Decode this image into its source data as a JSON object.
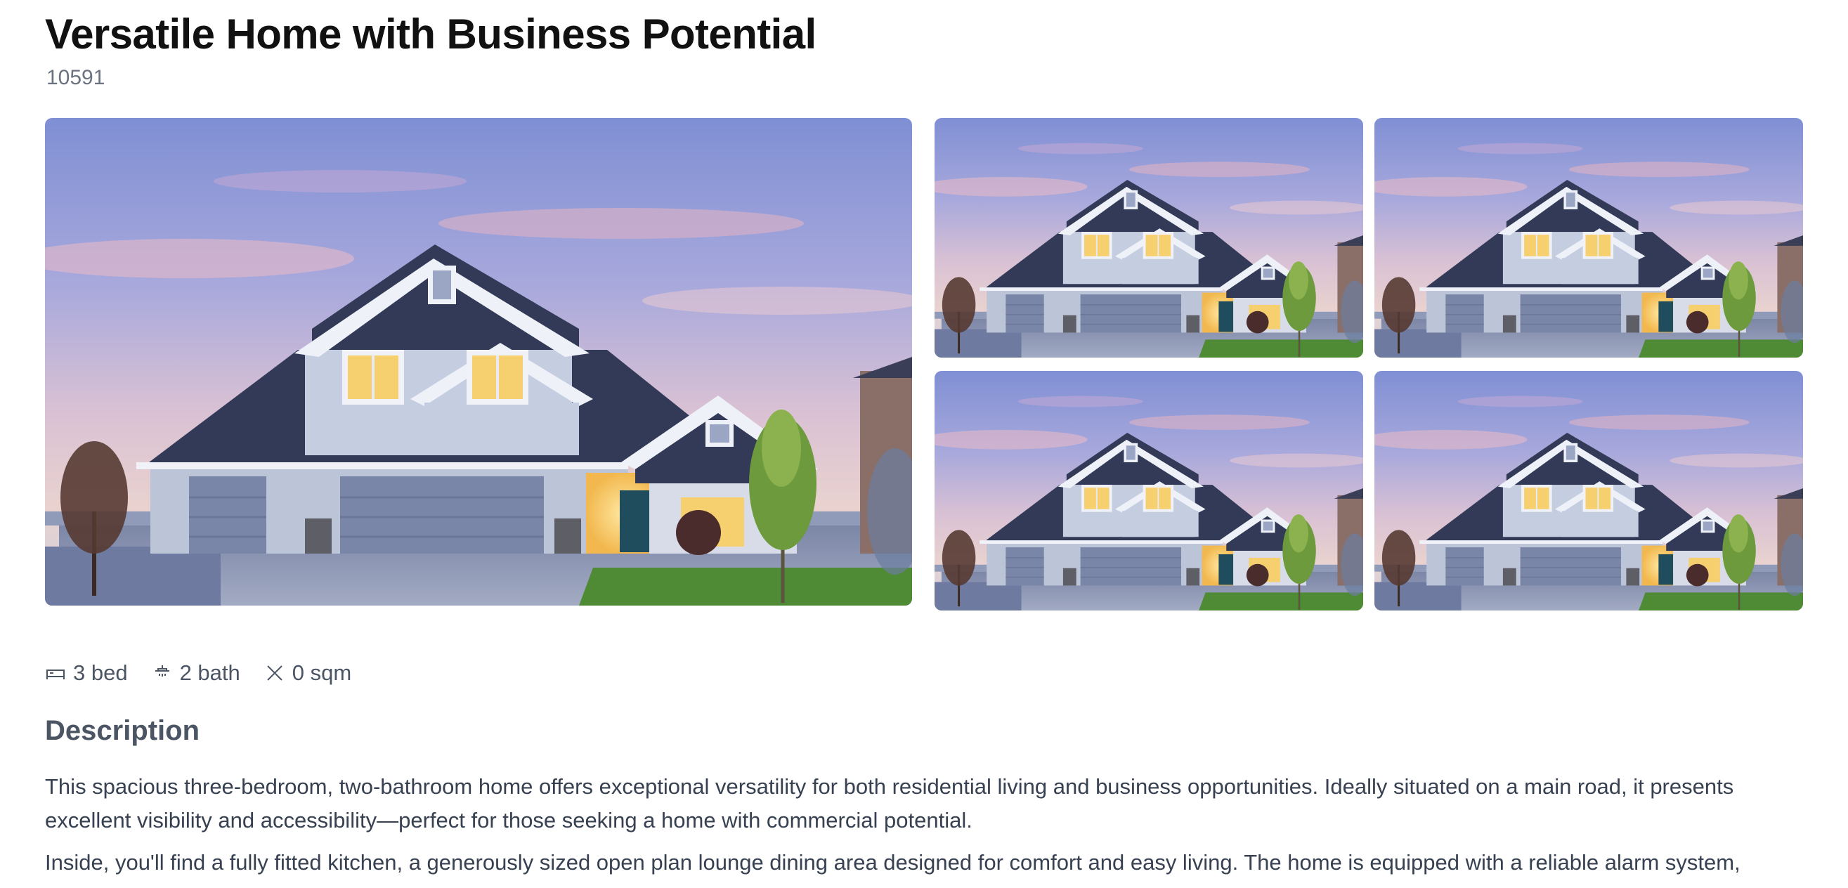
{
  "listing": {
    "title": "Versatile Home with Business Potential",
    "id": "10591"
  },
  "gallery": {
    "main_alt": "House exterior at dusk",
    "thumbnails": [
      "House exterior at dusk",
      "House exterior at dusk",
      "House exterior at dusk",
      "House exterior at dusk"
    ]
  },
  "features": {
    "beds": "3 bed",
    "baths": "2 bath",
    "area": "0 sqm",
    "icons": [
      "bed-icon",
      "shower-icon",
      "area-icon"
    ]
  },
  "description": {
    "heading": "Description",
    "paragraphs": [
      "This spacious three-bedroom, two-bathroom home offers exceptional versatility for both residential living and business opportunities. Ideally situated on a main road, it presents excellent visibility and accessibility—perfect for those seeking a home with commercial potential.",
      "Inside, you'll find a fully fitted kitchen, a generously sized open plan lounge dining area designed for comfort and easy living. The home is equipped with a reliable alarm system,"
    ]
  },
  "colors": {
    "text": "#111111",
    "muted": "#6b7280",
    "sky_top": "#8896d6",
    "roof": "#323a58",
    "siding": "#c5cde0",
    "window_light": "#f6cf6e",
    "lawn": "#4f8a34"
  }
}
